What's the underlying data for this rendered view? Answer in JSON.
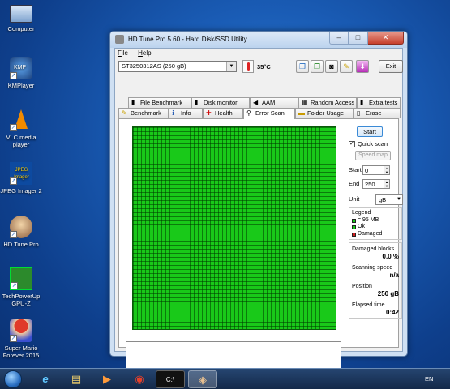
{
  "desktop": {
    "icons": [
      {
        "label": "Computer"
      },
      {
        "label": "KMPlayer",
        "badge": "KMP"
      },
      {
        "label": "VLC media player"
      },
      {
        "label": "JPEG Imager 2",
        "badge": "JPEG Imager"
      },
      {
        "label": "HD Tune Pro"
      },
      {
        "label": "TechPowerUp GPU-Z"
      },
      {
        "label": "Super Mario Forever 2015"
      }
    ]
  },
  "window": {
    "title": "HD Tune Pro 5.60 - Hard Disk/SSD Utility",
    "controls": {
      "minimize": "–",
      "maximize": "□",
      "close": "✕"
    },
    "menu": [
      {
        "label": "File",
        "key": "F",
        "rest": "ile"
      },
      {
        "label": "Help",
        "key": "H",
        "rest": "elp"
      }
    ],
    "drive": "ST3250312AS (250 gB)",
    "temperature": "35°C",
    "exit_label": "Exit",
    "tabs_row1": [
      {
        "label": "File Benchmark",
        "icon": "file-benchmark-icon"
      },
      {
        "label": "Disk monitor",
        "icon": "disk-monitor-icon"
      },
      {
        "label": "AAM",
        "icon": "speaker-icon"
      },
      {
        "label": "Random Access",
        "icon": "random-access-icon"
      },
      {
        "label": "Extra tests",
        "icon": "extra-tests-icon"
      }
    ],
    "tabs_row2": [
      {
        "label": "Benchmark",
        "icon": "benchmark-icon"
      },
      {
        "label": "Info",
        "icon": "info-icon"
      },
      {
        "label": "Health",
        "icon": "health-cross-icon"
      },
      {
        "label": "Error Scan",
        "icon": "magnifier-icon"
      },
      {
        "label": "Folder Usage",
        "icon": "folder-icon"
      },
      {
        "label": "Erase",
        "icon": "erase-icon"
      }
    ],
    "active_tab": "Error Scan",
    "scan": {
      "start_label": "Start",
      "quick_scan_label": "Quick scan",
      "quick_scan_checked": true,
      "speed_map_label": "Speed map",
      "start_label_field": "Start",
      "start_value": "0",
      "end_label": "End",
      "end_value": "250",
      "unit_label": "Unit",
      "unit_value": "gB",
      "legend": {
        "title": "Legend",
        "items": [
          {
            "label": "= 95 MB",
            "color": "#19c919"
          },
          {
            "label": "Ok",
            "color": "#19c919"
          },
          {
            "label": "Damaged",
            "color": "#d02020"
          }
        ]
      },
      "stats": {
        "damaged_blocks_label": "Damaged blocks",
        "damaged_blocks_value": "0.0 %",
        "scanning_speed_label": "Scanning speed",
        "scanning_speed_value": "n/a",
        "position_label": "Position",
        "position_value": "250 gB",
        "elapsed_label": "Elapsed time",
        "elapsed_value": "0:42"
      },
      "block_ok_color": "#19c919"
    }
  },
  "taskbar": {
    "items": [
      {
        "name": "internet-explorer-icon",
        "glyph": "e"
      },
      {
        "name": "file-explorer-icon",
        "glyph": "▤"
      },
      {
        "name": "media-player-icon",
        "glyph": "▶"
      },
      {
        "name": "chrome-icon",
        "glyph": "◉"
      },
      {
        "name": "command-prompt-icon",
        "glyph": "C:\\"
      },
      {
        "name": "hd-tune-taskbar-icon",
        "glyph": "◈"
      }
    ],
    "language": "EN"
  }
}
